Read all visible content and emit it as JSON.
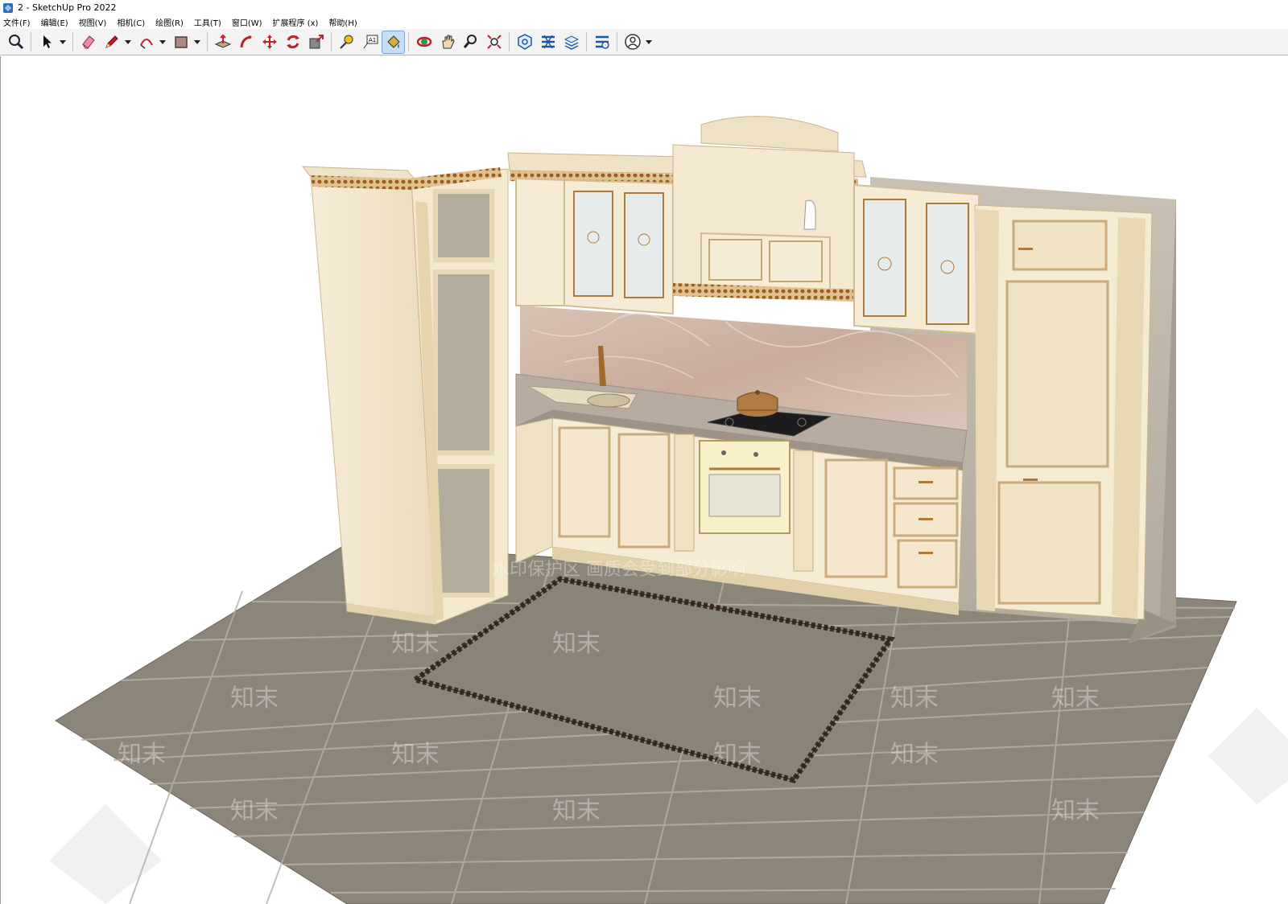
{
  "window": {
    "title": "2 - SketchUp Pro 2022"
  },
  "menu": [
    {
      "label": "文件(F)"
    },
    {
      "label": "编辑(E)"
    },
    {
      "label": "视图(V)"
    },
    {
      "label": "相机(C)"
    },
    {
      "label": "绘图(R)"
    },
    {
      "label": "工具(T)"
    },
    {
      "label": "窗口(W)"
    },
    {
      "label": "扩展程序 (x)"
    },
    {
      "label": "帮助(H)"
    }
  ],
  "toolbar": {
    "tools": [
      {
        "icon": "zoom-icon"
      },
      {
        "icon": "select-icon"
      },
      {
        "icon": "eraser-icon"
      },
      {
        "icon": "pencil-icon"
      },
      {
        "icon": "arc-icon"
      },
      {
        "icon": "rectangle-icon"
      },
      {
        "icon": "push-pull-icon"
      },
      {
        "icon": "follow-me-icon"
      },
      {
        "icon": "move-icon"
      },
      {
        "icon": "rotate-icon"
      },
      {
        "icon": "scale-icon"
      },
      {
        "icon": "tape-measure-icon"
      },
      {
        "icon": "text-icon",
        "text": "A1"
      },
      {
        "icon": "paint-bucket-icon",
        "active": true
      },
      {
        "icon": "orbit-icon"
      },
      {
        "icon": "pan-icon"
      },
      {
        "icon": "zoom-window-icon"
      },
      {
        "icon": "zoom-extents-icon"
      },
      {
        "icon": "warehouse-icon"
      },
      {
        "icon": "extension-warehouse-icon"
      },
      {
        "icon": "layout-icon"
      },
      {
        "icon": "extension-manager-icon"
      },
      {
        "icon": "account-icon"
      }
    ]
  },
  "viewport": {
    "watermark_banner": "水印保护区  画质会受到部分影响",
    "watermark_tile": "知末",
    "colors": {
      "cabinet": "#f6ead2",
      "cabinet_shadow": "#ddccab",
      "gold_trim": "#b07a3a",
      "floor_tile": "#8e877c",
      "countertop": "#b5a89c",
      "backsplash": "#cdb5a6"
    }
  }
}
